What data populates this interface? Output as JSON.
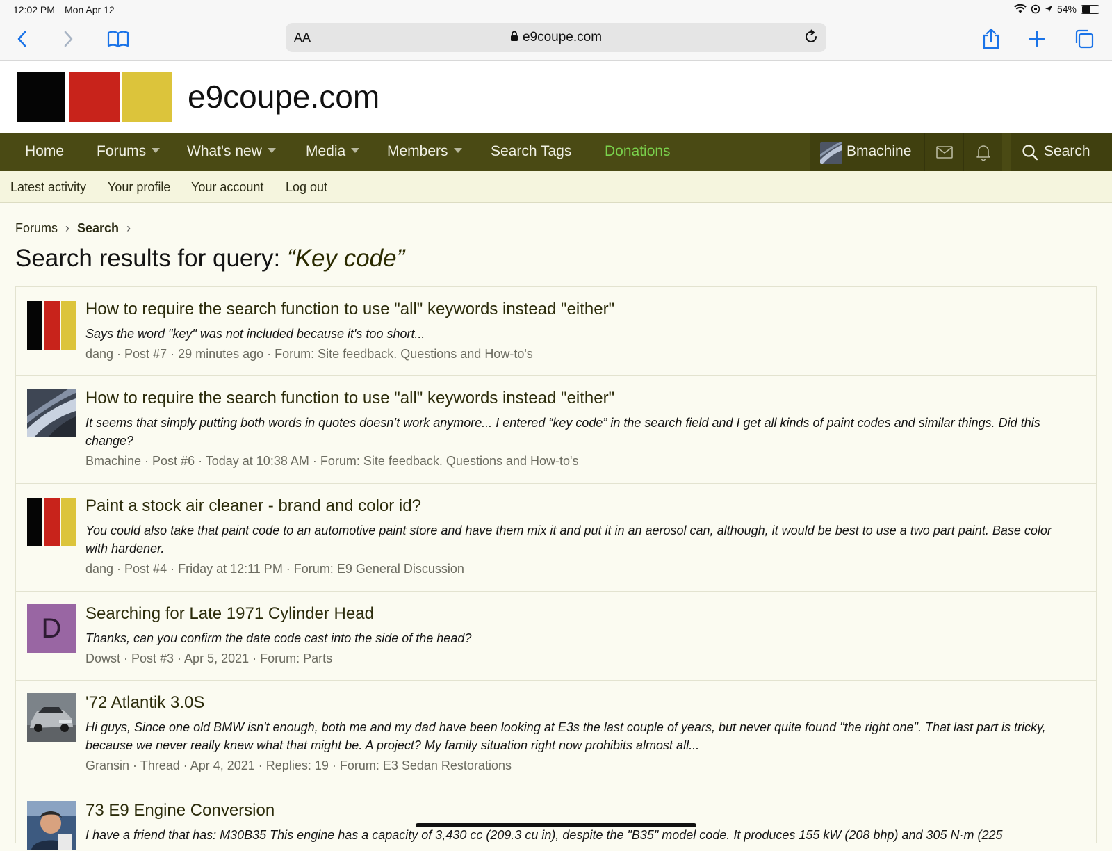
{
  "status": {
    "time": "12:02 PM",
    "date": "Mon Apr 12",
    "battery": "54%",
    "battery_level": 0.54
  },
  "browser": {
    "text_size_label": "AA",
    "url": "e9coupe.com"
  },
  "site": {
    "title": "e9coupe.com",
    "logo_colors": [
      "#050505",
      "#c8231b",
      "#dcc43b"
    ]
  },
  "nav": {
    "home": "Home",
    "forums": "Forums",
    "whats_new": "What's new",
    "media": "Media",
    "members": "Members",
    "search_tags": "Search Tags",
    "donations": "Donations",
    "user": "Bmachine",
    "search": "Search"
  },
  "subnav": {
    "latest": "Latest activity",
    "profile": "Your profile",
    "account": "Your account",
    "logout": "Log out"
  },
  "breadcrumb": {
    "forums": "Forums",
    "search": "Search"
  },
  "page": {
    "title_prefix": "Search results for query: ",
    "query": "“Key code”"
  },
  "results": [
    {
      "title": "How to require the search function to use \"all\" keywords instead \"either\"",
      "snippet": "Says the word \"key\" was not included because it's too short...",
      "meta": "dang · Post #7 · 29 minutes ago · Forum: Site feedback. Questions and How-to's",
      "avatar": "logo"
    },
    {
      "title": "How to require the search function to use \"all\" keywords instead \"either\"",
      "snippet": "It seems that simply putting both words in quotes doesn’t work anymore... I entered “key code” in the search field and I get all kinds of paint codes and similar things. Did this change?",
      "meta": "Bmachine · Post #6 · Today at 10:38 AM · Forum: Site feedback. Questions and How-to's",
      "avatar": "car-chrome"
    },
    {
      "title": "Paint a stock air cleaner - brand and color id?",
      "snippet": "You could also take that paint code to an automotive paint store and have them mix it and put it in an aerosol can, although, it would be best to use a two part paint. Base color with hardener.",
      "meta": "dang · Post #4 · Friday at 12:11 PM · Forum: E9 General Discussion",
      "avatar": "logo"
    },
    {
      "title": "Searching for Late 1971 Cylinder Head",
      "snippet": "Thanks, can you confirm the date code cast into the side of the head?",
      "meta": "Dowst · Post #3 · Apr 5, 2021 · Forum: Parts",
      "avatar": "letter",
      "avatar_letter": "D"
    },
    {
      "title": "'72 Atlantik 3.0S",
      "snippet": "Hi guys, Since one old BMW isn't enough, both me and my dad have been looking at E3s the last couple of years, but never quite found \"the right one\". That last part is tricky, because we never really knew what that might be. A project? My family situation right now prohibits almost all...",
      "meta": "Gransin · Thread · Apr 4, 2021 · Replies: 19 · Forum: E3 Sedan Restorations",
      "avatar": "car-photo"
    },
    {
      "title": "73 E9 Engine Conversion",
      "snippet": "I have a friend that has: M30B35 This engine has a capacity of 3,430 cc (209.3 cu in), despite the \"B35\" model code. It produces 155 kW (208 bhp) and 305 N·m (225",
      "meta": "",
      "avatar": "person-photo"
    }
  ]
}
